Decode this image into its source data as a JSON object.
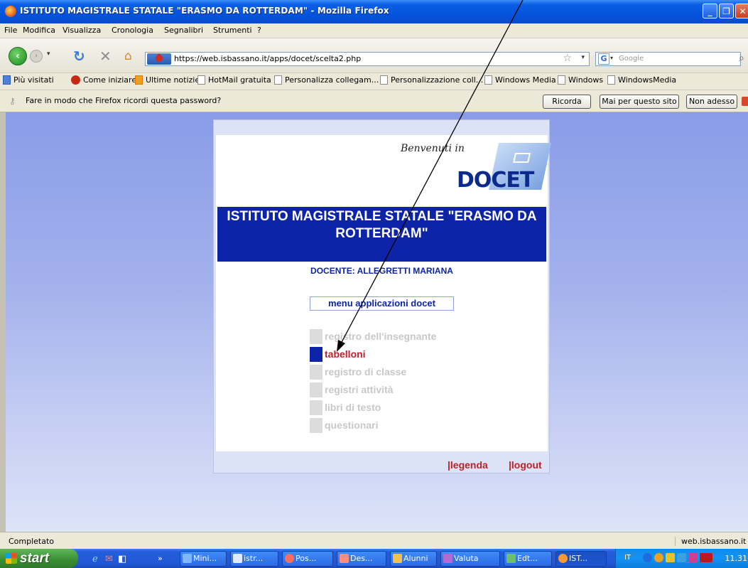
{
  "window": {
    "title": "ISTITUTO MAGISTRALE STATALE \"ERASMO DA ROTTERDAM\" - Mozilla Firefox",
    "min": "_",
    "max": "❐",
    "close": "✕"
  },
  "menubar": [
    "File",
    "Modifica",
    "Visualizza",
    "Cronologia",
    "Segnalibri",
    "Strumenti",
    "?"
  ],
  "nav": {
    "url": "https://web.isbassano.it/apps/docet/scelta2.php",
    "search_placeholder": "Google"
  },
  "bookmarks": [
    "Più visitati",
    "Come iniziare",
    "Ultime notizie",
    "HotMail gratuita",
    "Personalizza collegam...",
    "Personalizzazione coll...",
    "Windows Media",
    "Windows",
    "WindowsMedia"
  ],
  "password_bar": {
    "message": "Fare in modo che Firefox ricordi questa password?",
    "btn_remember": "Ricorda",
    "btn_never": "Mai per questo sito",
    "btn_not_now": "Non adesso"
  },
  "page": {
    "welcome": "Benvenuti in",
    "logo": "DOCET",
    "school": "ISTITUTO MAGISTRALE STATALE \"ERASMO DA ROTTERDAM\"",
    "teacher": "DOCENTE: ALLEGRETTI MARIANA",
    "menu_title": "menu applicazioni docet",
    "menu_items": [
      {
        "label": "registro dell'insegnante",
        "active": false
      },
      {
        "label": "tabelloni",
        "active": true
      },
      {
        "label": "registro di classe",
        "active": false
      },
      {
        "label": "registri attività",
        "active": false
      },
      {
        "label": "libri di testo",
        "active": false
      },
      {
        "label": "questionari",
        "active": false
      }
    ],
    "footer_legenda": "|legenda",
    "footer_logout": "|logout"
  },
  "status": {
    "text": "Completato",
    "host": "web.isbassano.it"
  },
  "taskbar": {
    "start": "start",
    "tasks": [
      "Mini...",
      "istr...",
      "Pos...",
      "Des...",
      "Alunni",
      "Valuta",
      "Edt...",
      "IST..."
    ],
    "lang": "IT",
    "clock": "11.31"
  },
  "colors": {
    "accent_blue": "#0d24a8",
    "active_red": "#c0202a",
    "inactive_gray": "#c8c8c8"
  }
}
